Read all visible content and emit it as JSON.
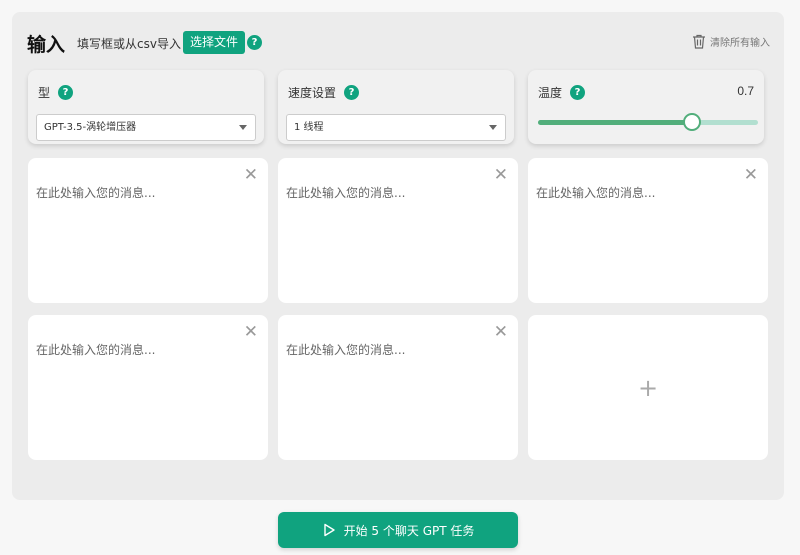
{
  "header": {
    "title": "输入",
    "subtitle": "填写框或从csv导入",
    "file_button": "选择文件",
    "help": "?",
    "clear_all": "清除所有输入",
    "clear_icon": "trash-icon"
  },
  "settings": {
    "model": {
      "label": "型",
      "value": "GPT-3.5-涡轮增压器"
    },
    "speed": {
      "label": "速度设置",
      "value": "1 线程"
    },
    "temperature": {
      "label": "温度",
      "value": "0.7",
      "fraction": 0.7
    }
  },
  "messages": [
    {
      "placeholder": "在此处输入您的消息..."
    },
    {
      "placeholder": "在此处输入您的消息..."
    },
    {
      "placeholder": "在此处输入您的消息..."
    },
    {
      "placeholder": "在此处输入您的消息..."
    },
    {
      "placeholder": "在此处输入您的消息..."
    }
  ],
  "close_glyph": "✕",
  "add_glyph": "+",
  "start_button": {
    "label": "开始 5 个聊天 GPT 任务",
    "icon": "play-icon"
  },
  "colors": {
    "accent": "#10a37f",
    "slider": "#52ae7b"
  }
}
